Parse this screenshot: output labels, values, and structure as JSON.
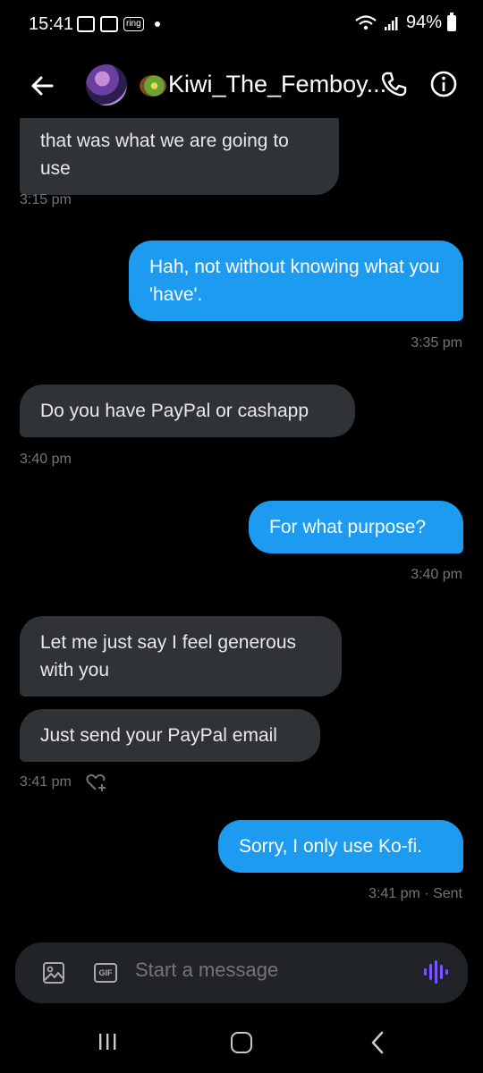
{
  "status_bar": {
    "time": "15:41",
    "battery": "94%",
    "ring_label": "ring"
  },
  "header": {
    "name": "Kiwi_The_Femboy...",
    "avatar_icon": "user-avatar",
    "emoji_icon": "kiwi-emoji"
  },
  "messages": [
    {
      "direction": "incoming",
      "text": "that was what we are going to use"
    },
    {
      "direction": "timestamp",
      "text": "3:15 pm"
    },
    {
      "direction": "outgoing",
      "text": "Hah, not without knowing what you 'have'."
    },
    {
      "direction": "timestamp",
      "text": "3:35 pm"
    },
    {
      "direction": "incoming",
      "text": "Do you have PayPal or cashapp"
    },
    {
      "direction": "timestamp",
      "text": "3:40 pm"
    },
    {
      "direction": "outgoing",
      "text": "For what purpose?"
    },
    {
      "direction": "timestamp",
      "text": "3:40 pm"
    },
    {
      "direction": "incoming",
      "text": "Let me just say I feel generous with you"
    },
    {
      "direction": "incoming",
      "text": "Just send your PayPal email"
    },
    {
      "direction": "timestamp",
      "text": "3:41 pm"
    },
    {
      "direction": "outgoing",
      "text": "Sorry, I only use Ko-fi."
    },
    {
      "direction": "timestamp",
      "text": "3:41 pm · Sent"
    }
  ],
  "composer": {
    "placeholder": "Start a message",
    "gif_label": "GIF"
  },
  "colors": {
    "accent": "#1d9bf0",
    "incoming_bubble": "#2f3336",
    "voice": "#7856ff"
  }
}
